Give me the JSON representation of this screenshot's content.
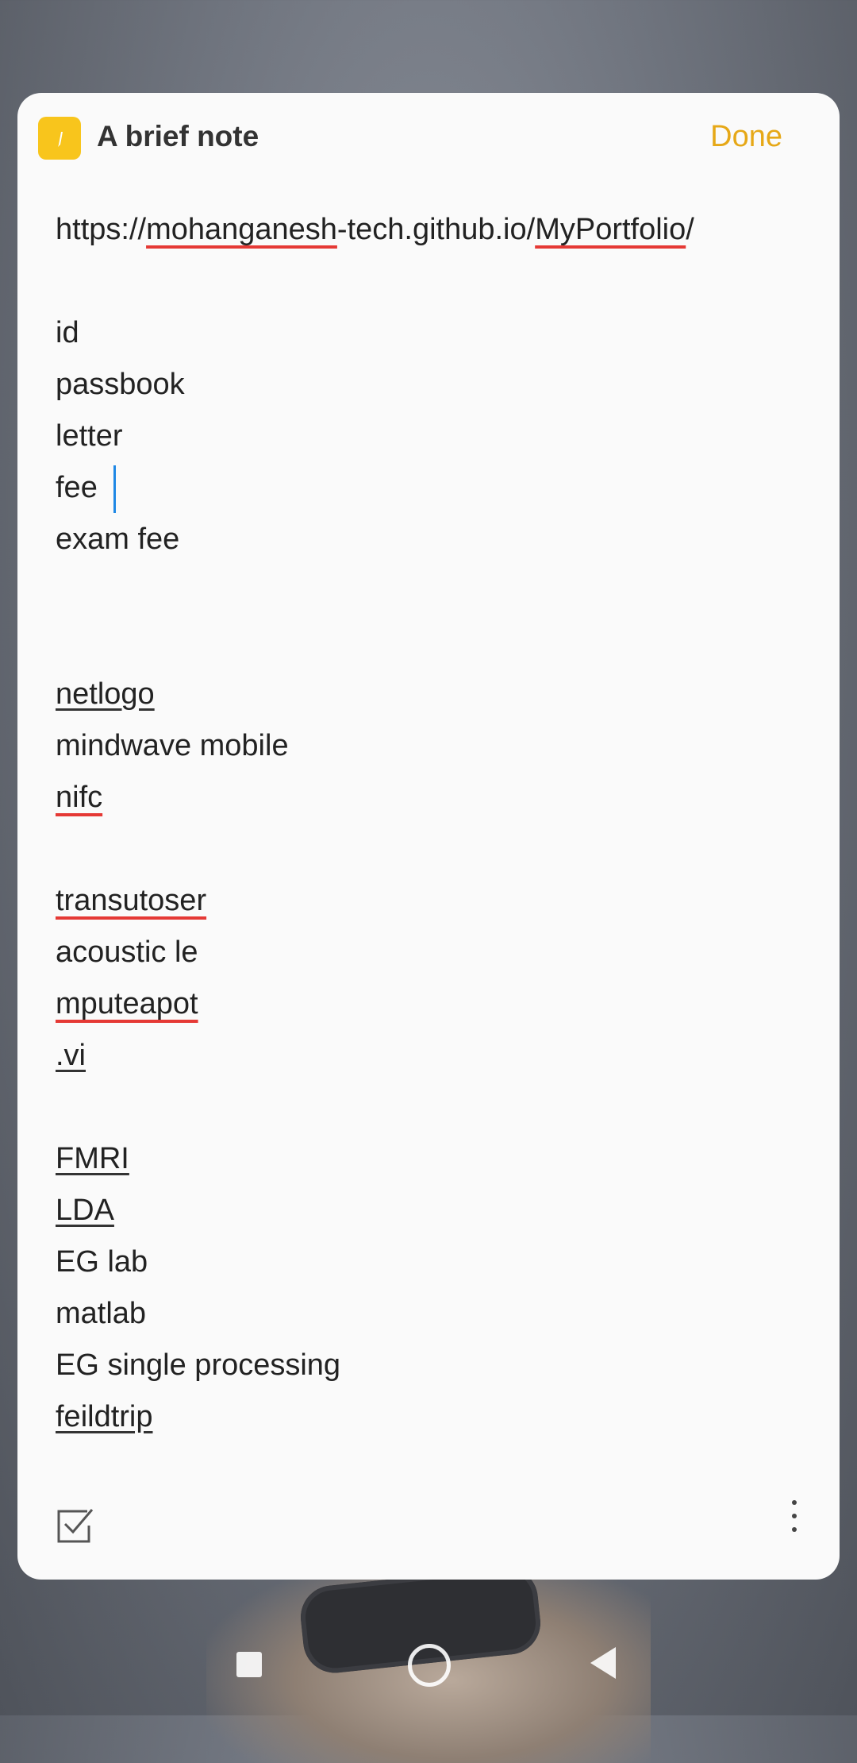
{
  "header": {
    "title": "A brief note",
    "done_label": "Done"
  },
  "note": {
    "url_parts": [
      "https://",
      "mohanganesh",
      "-tech.github.io/",
      "MyPortfolio",
      "/"
    ],
    "lines": [
      "id",
      "passbook",
      "letter",
      "fee ",
      "exam fee",
      "netlogo",
      "mindwave mobile",
      "nifc",
      "transutoser",
      "acoustic le",
      "mputeapot",
      ".vi",
      "FMRI",
      "LDA",
      "EG lab",
      "matlab",
      "EG single processing",
      "feildtrip"
    ]
  },
  "icons": {
    "app_icon": "pencil-note-icon",
    "checklist": "checkbox-icon",
    "more": "more-vertical-icon",
    "nav": [
      "square-recents-icon",
      "circle-home-icon",
      "triangle-back-icon"
    ]
  },
  "colors": {
    "accent": "#e6a817",
    "app_icon_bg": "#f8c51c",
    "spell_error": "#e53935",
    "cursor": "#1e88e5"
  }
}
